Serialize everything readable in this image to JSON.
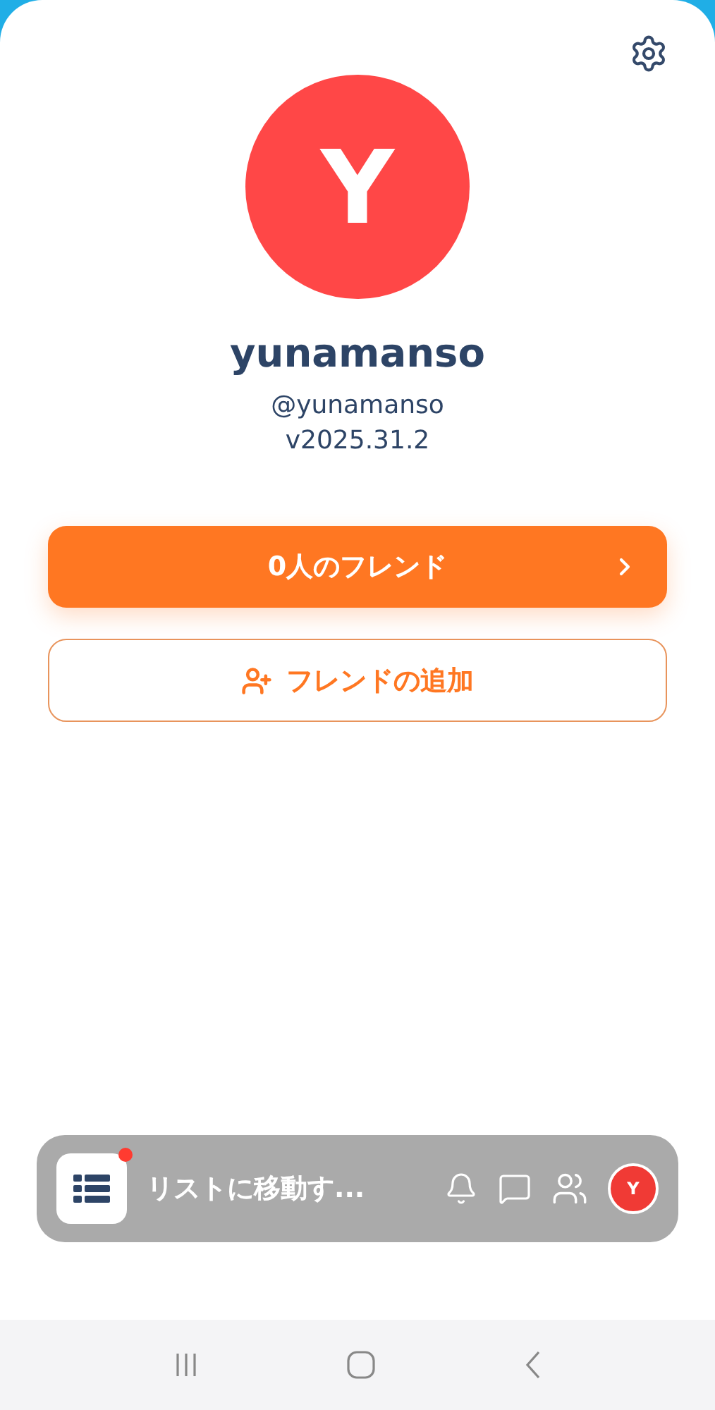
{
  "profile": {
    "avatar_letter": "Y",
    "name": "yunamanso",
    "handle": "@yunamanso",
    "version": "v2025.31.2"
  },
  "friends_button": {
    "label": "0人のフレンド"
  },
  "add_friend_button": {
    "label": "フレンドの追加"
  },
  "bottom_bar": {
    "list_label": "リストに移動す...",
    "list_badge": true,
    "avatar_letter": "Y"
  }
}
